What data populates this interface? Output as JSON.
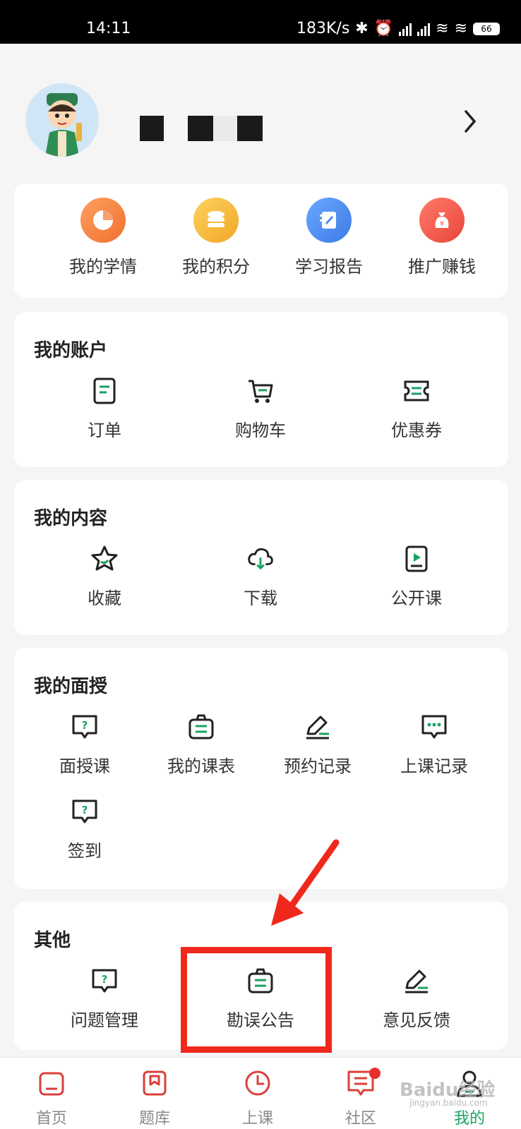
{
  "status": {
    "time": "14:11",
    "network_speed": "183K/s",
    "battery": "66"
  },
  "profile": {
    "name_redacted": true
  },
  "quick_actions": [
    {
      "label": "我的学情",
      "icon": "pie-chart-icon",
      "color": "#f57c3a"
    },
    {
      "label": "我的积分",
      "icon": "coin-stack-icon",
      "color": "#f2b431"
    },
    {
      "label": "学习报告",
      "icon": "notebook-edit-icon",
      "color": "#4d8ff0"
    },
    {
      "label": "推广赚钱",
      "icon": "money-bag-icon",
      "color": "#f25a4a"
    }
  ],
  "account": {
    "title": "我的账户",
    "items": [
      {
        "label": "订单",
        "icon": "order-doc-icon"
      },
      {
        "label": "购物车",
        "icon": "cart-icon"
      },
      {
        "label": "优惠券",
        "icon": "ticket-icon"
      }
    ]
  },
  "content": {
    "title": "我的内容",
    "items": [
      {
        "label": "收藏",
        "icon": "star-icon"
      },
      {
        "label": "下载",
        "icon": "cloud-download-icon"
      },
      {
        "label": "公开课",
        "icon": "video-play-icon"
      }
    ]
  },
  "tutoring": {
    "title": "我的面授",
    "items": [
      {
        "label": "面授课",
        "icon": "question-bubble-icon"
      },
      {
        "label": "我的课表",
        "icon": "schedule-bag-icon"
      },
      {
        "label": "预约记录",
        "icon": "pencil-line-icon"
      },
      {
        "label": "上课记录",
        "icon": "chat-dots-icon"
      },
      {
        "label": "签到",
        "icon": "question-bubble-icon"
      }
    ]
  },
  "other": {
    "title": "其他",
    "items": [
      {
        "label": "问题管理",
        "icon": "question-bubble-icon"
      },
      {
        "label": "勘误公告",
        "icon": "notice-bag-icon"
      },
      {
        "label": "意见反馈",
        "icon": "pencil-line-icon"
      }
    ]
  },
  "tabbar": [
    {
      "label": "首页",
      "icon": "home-icon",
      "active": false
    },
    {
      "label": "题库",
      "icon": "bookmark-icon",
      "active": false
    },
    {
      "label": "上课",
      "icon": "clock-icon",
      "active": false
    },
    {
      "label": "社区",
      "icon": "message-icon",
      "active": false,
      "badge": true
    },
    {
      "label": "我的",
      "icon": "user-icon",
      "active": true
    }
  ],
  "colors": {
    "accent_green": "#1aa260",
    "tab_red": "#d9403a",
    "highlight_red": "#f0281c"
  },
  "watermark": {
    "text": "Baidu经验",
    "sub": "jingyan.baidu.com"
  }
}
